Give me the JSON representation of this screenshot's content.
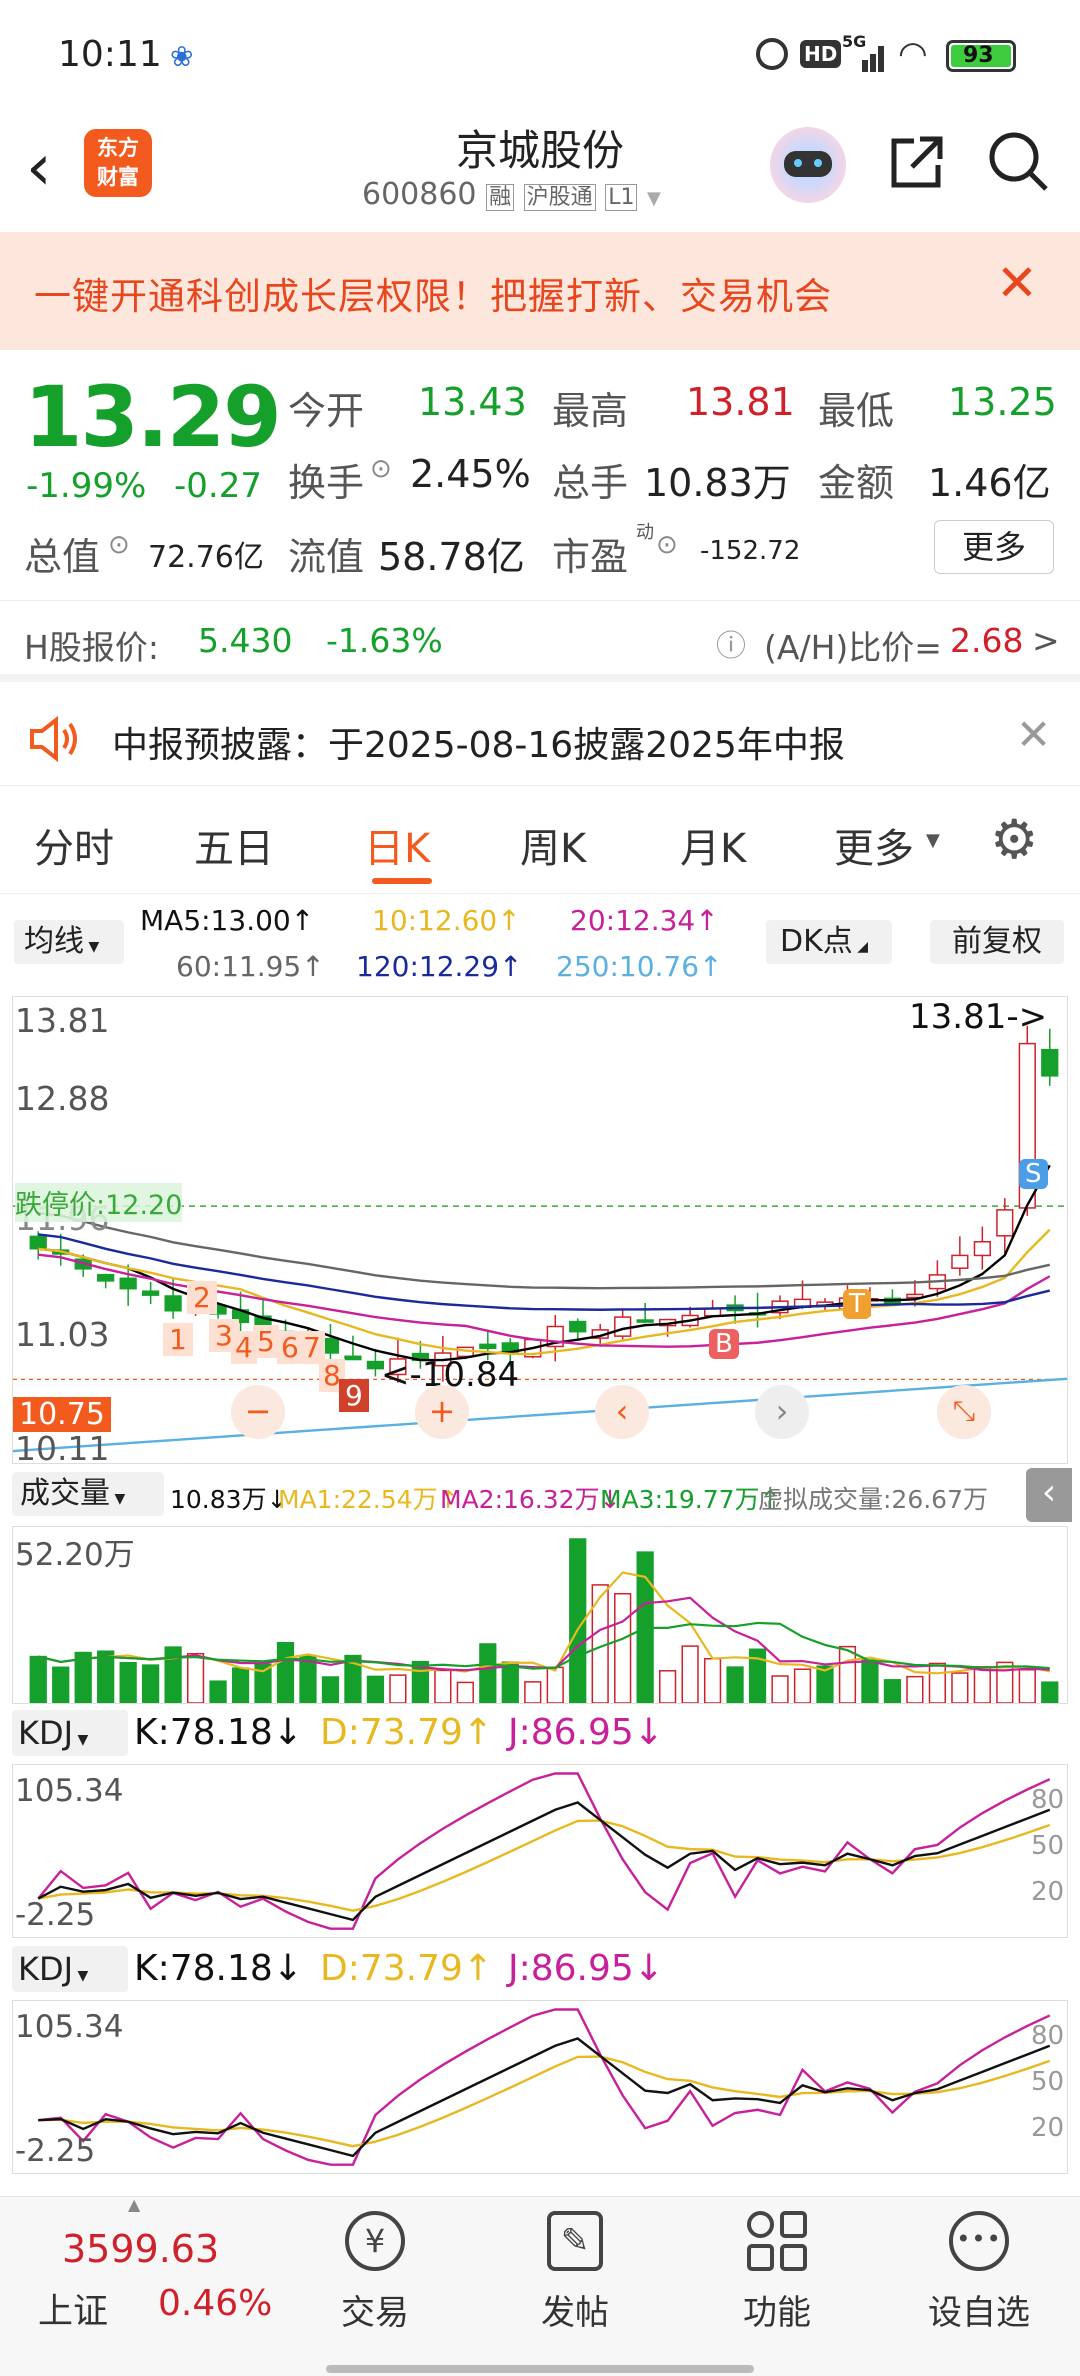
{
  "status_bar": {
    "time": "10:11",
    "hd": "HD",
    "net": "5G",
    "battery": "93"
  },
  "header": {
    "logo_line1": "东方",
    "logo_line2": "财富",
    "title": "京城股份",
    "code": "600860",
    "tag_rong": "融",
    "tag_hgt": "沪股通",
    "tag_level": "L1"
  },
  "banner": {
    "text": "一键开通科创成长层权限！把握打新、交易机会"
  },
  "quote": {
    "price": "13.29",
    "change_pct": "-1.99%",
    "change": "-0.27",
    "open_label": "今开",
    "open": "13.43",
    "high_label": "最高",
    "high": "13.81",
    "low_label": "最低",
    "low": "13.25",
    "turnover_label": "换手",
    "turnover": "2.45%",
    "volume_label": "总手",
    "volume": "10.83万",
    "amount_label": "金额",
    "amount": "1.46亿",
    "mktcap_label": "总值",
    "mktcap": "72.76亿",
    "float_label": "流值",
    "float": "58.78亿",
    "pe_label": "市盈",
    "pe_sup": "动",
    "pe": "-152.72",
    "more": "更多",
    "h_label": "H股报价:",
    "h_price": "5.430",
    "h_change": "-1.63%",
    "ah_label": "(A/H)比价=",
    "ah_value": "2.68",
    "ah_arrow": ">"
  },
  "notice": {
    "text": "中报预披露：于2025-08-16披露2025年中报"
  },
  "tabs": [
    "分时",
    "五日",
    "日K",
    "周K",
    "月K",
    "更多"
  ],
  "ma_panel": {
    "selector": "均线",
    "ma5": "MA5:13.00↑",
    "ma10": "10:12.60↑",
    "ma20": "20:12.34↑",
    "ma60": "60:11.95↑",
    "ma120": "120:12.29↑",
    "ma250": "250:10.76↑",
    "dk": "DK点",
    "fq": "前复权"
  },
  "chart_labels": {
    "y_top": "13.81",
    "y_mid": "12.88",
    "y_low": "11.03",
    "y_bot": "10.11",
    "y_96": "11.96",
    "limit_down": "跌停价:12.20",
    "max_marker": "13.81->",
    "min_marker": "<-10.84",
    "current_line": "10.75",
    "seq": [
      "1",
      "2",
      "3",
      "4",
      "5",
      "6",
      "7",
      "8",
      "9"
    ],
    "signal_b": "B",
    "signal_t": "T",
    "signal_s": "S"
  },
  "volume_panel": {
    "selector": "成交量",
    "vol": "10.83万↓",
    "ma1": "MA1:22.54万↑",
    "ma2": "MA2:16.32万↓",
    "ma3": "MA3:19.77万↑",
    "virtual": "虚拟成交量:26.67万",
    "y_top": "52.20万"
  },
  "kdj1": {
    "selector": "KDJ",
    "k": "K:78.18↓",
    "d": "D:73.79↑",
    "j": "J:86.95↓",
    "y_top": "105.34",
    "y_bot": "-2.25",
    "r80": "80",
    "r50": "50",
    "r20": "20"
  },
  "kdj2": {
    "selector": "KDJ",
    "k": "K:78.18↓",
    "d": "D:73.79↑",
    "j": "J:86.95↓",
    "y_top": "105.34",
    "y_bot": "-2.25",
    "r80": "80",
    "r50": "50",
    "r20": "20"
  },
  "bottom_nav": {
    "index_value": "3599.63",
    "index_name": "上证",
    "index_change": "0.46%",
    "items": [
      "交易",
      "发帖",
      "功能",
      "设自选"
    ]
  },
  "colors": {
    "up": "#d0202a",
    "down": "#14a02a",
    "ma5": "#000000",
    "ma10": "#e8b820",
    "ma20": "#c8209a",
    "ma60": "#666666",
    "ma120": "#1a2a9a",
    "ma250": "#5ab0e0",
    "accent": "#f35a1e"
  }
}
